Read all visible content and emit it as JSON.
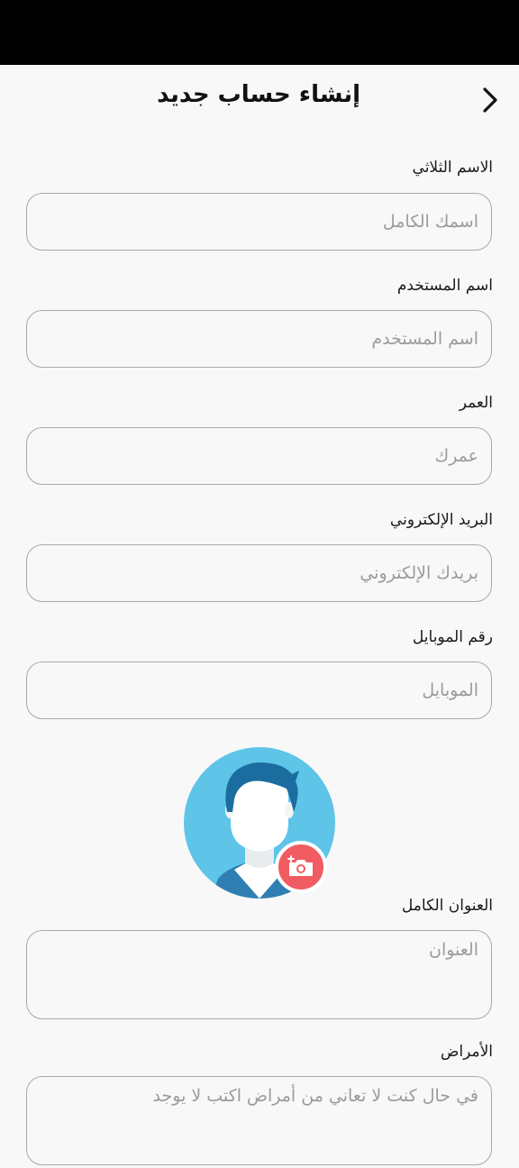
{
  "header": {
    "title": "إنشاء حساب جديد",
    "back_icon": "chevron-right-icon"
  },
  "form": {
    "full_name": {
      "label": "الاسم الثلاثي",
      "placeholder": "اسمك الكامل"
    },
    "username": {
      "label": "اسم المستخدم",
      "placeholder": "اسم المستخدم"
    },
    "age": {
      "label": "العمر",
      "placeholder": "عمرك"
    },
    "email": {
      "label": "البريد الإلكتروني",
      "placeholder": "بريدك الإلكتروني"
    },
    "mobile": {
      "label": "رقم الموبايل",
      "placeholder": "الموبايل"
    },
    "address": {
      "label": "العنوان الكامل",
      "placeholder": "العنوان"
    },
    "diseases": {
      "label": "الأمراض",
      "placeholder": "في حال كنت لا تعاني من أمراض اكتب لا يوجد"
    }
  },
  "avatar": {
    "icon": "default-avatar",
    "add_photo_icon": "add-photo-icon"
  },
  "colors": {
    "accent_red": "#f15c62",
    "avatar_bg": "#5ec4e8",
    "field_border": "#a9a9a9"
  }
}
